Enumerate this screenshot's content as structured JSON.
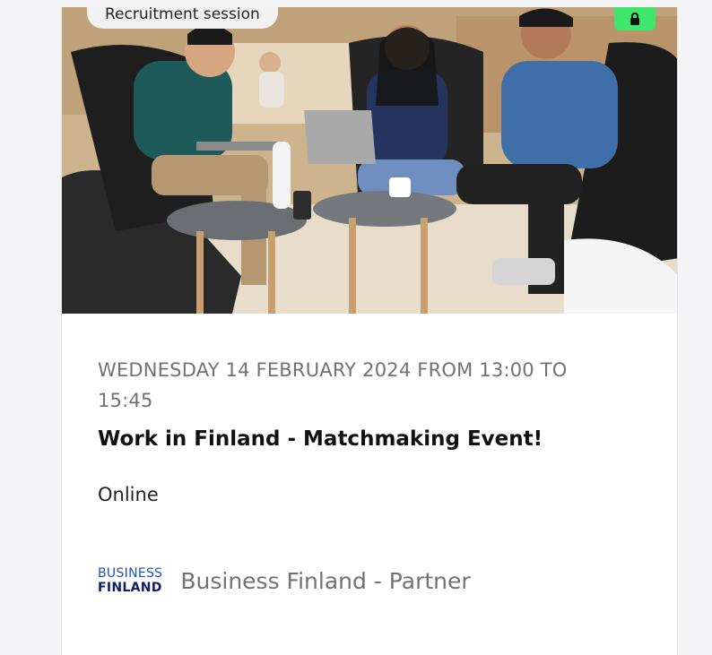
{
  "event_card": {
    "category_badge": "Recruitment session",
    "lock_icon": "lock-icon",
    "date_text": "Wednesday 14 February 2024 from 13:00 to 15:45",
    "title": "Work in Finland - Matchmaking Event!",
    "location": "Online",
    "organizer": {
      "logo_line1": "BUSINESS",
      "logo_line2": "FINLAND",
      "name": "Business Finland - Partner"
    }
  },
  "colors": {
    "badge_bg": "#f1f1f1",
    "lock_bg": "#3ee66a",
    "logo_blue": "#1f4fbf",
    "logo_navy": "#0b1f6a",
    "muted_text": "#727272"
  }
}
